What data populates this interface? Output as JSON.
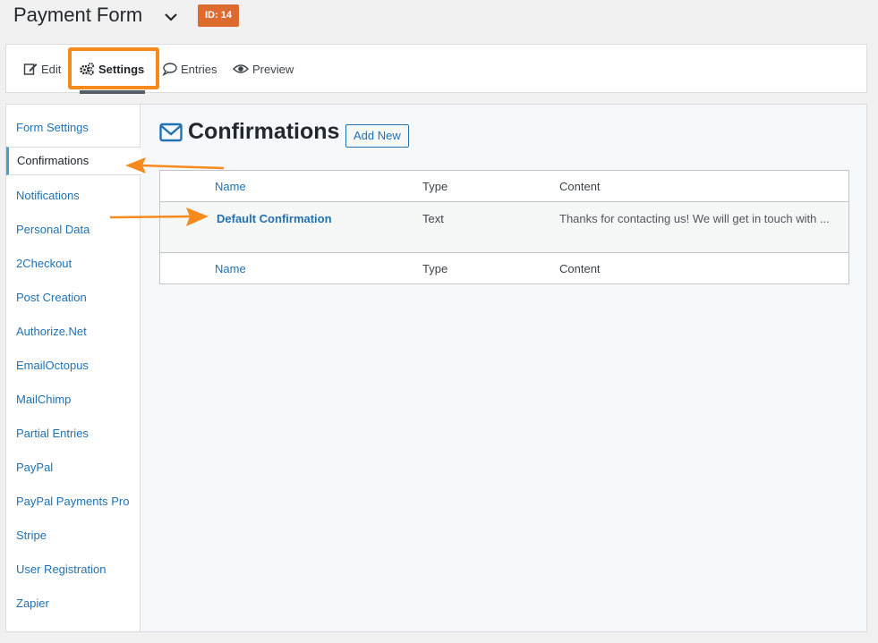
{
  "header": {
    "title": "Payment Form",
    "id_badge": "ID: 14"
  },
  "tabs": [
    {
      "label": "Edit",
      "icon": "edit-icon"
    },
    {
      "label": "Settings",
      "icon": "gears-icon",
      "active": true
    },
    {
      "label": "Entries",
      "icon": "comment-icon"
    },
    {
      "label": "Preview",
      "icon": "eye-icon"
    }
  ],
  "sidebar": {
    "items": [
      {
        "label": "Form Settings"
      },
      {
        "label": "Confirmations",
        "active": true
      },
      {
        "label": "Notifications"
      },
      {
        "label": "Personal Data"
      },
      {
        "label": "2Checkout"
      },
      {
        "label": "Post Creation"
      },
      {
        "label": "Authorize.Net"
      },
      {
        "label": "EmailOctopus"
      },
      {
        "label": "MailChimp"
      },
      {
        "label": "Partial Entries"
      },
      {
        "label": "PayPal"
      },
      {
        "label": "PayPal Payments Pro"
      },
      {
        "label": "Stripe"
      },
      {
        "label": "User Registration"
      },
      {
        "label": "Zapier"
      }
    ]
  },
  "main": {
    "title": "Confirmations",
    "title_icon": "envelope-icon",
    "add_new_label": "Add New",
    "table": {
      "columns": [
        "Name",
        "Type",
        "Content"
      ],
      "rows": [
        {
          "name": "Default Confirmation",
          "type": "Text",
          "content": "Thanks for contacting us! We will get in touch with ..."
        }
      ]
    }
  },
  "colors": {
    "accent": "#2271b1",
    "badge": "#dd6a2f",
    "highlight": "#f78a1d"
  }
}
